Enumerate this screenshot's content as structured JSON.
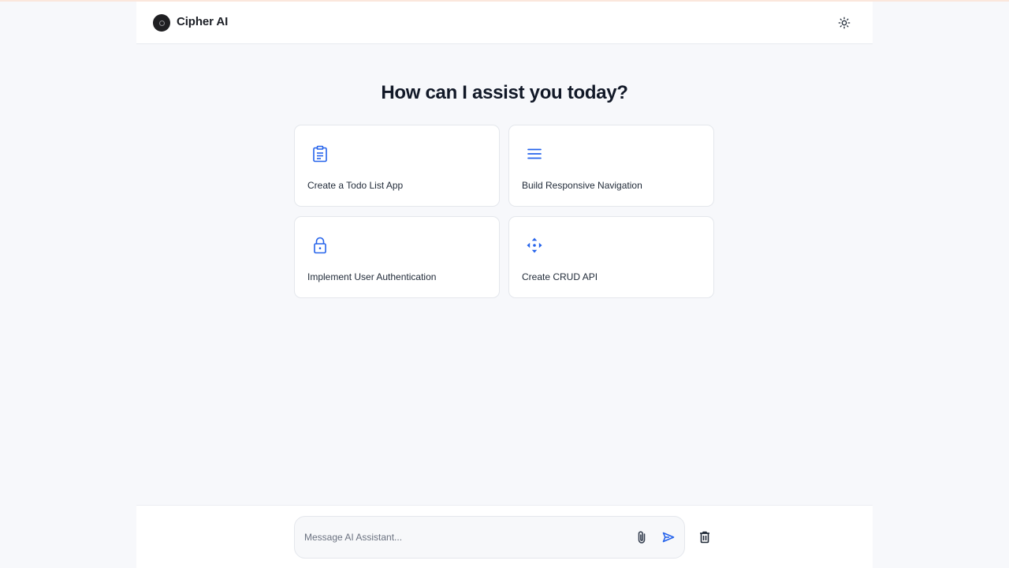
{
  "header": {
    "brand": "Cipher AI",
    "logo_icon": "cipher-logo",
    "theme_toggle_icon": "sun-icon"
  },
  "main": {
    "heading": "How can I assist you today?",
    "suggestions": [
      {
        "label": "Create a Todo List App",
        "icon": "clipboard-list-icon"
      },
      {
        "label": "Build Responsive Navigation",
        "icon": "menu-icon"
      },
      {
        "label": "Implement User Authentication",
        "icon": "lock-icon"
      },
      {
        "label": "Create CRUD API",
        "icon": "api-arrows-icon"
      }
    ]
  },
  "composer": {
    "placeholder": "Message AI Assistant...",
    "value": "",
    "attach_icon": "paperclip-icon",
    "send_icon": "send-icon",
    "clear_icon": "trash-icon"
  },
  "colors": {
    "accent": "#2563eb",
    "background": "#f7f8fb",
    "surface": "#ffffff",
    "text": "#111827"
  }
}
